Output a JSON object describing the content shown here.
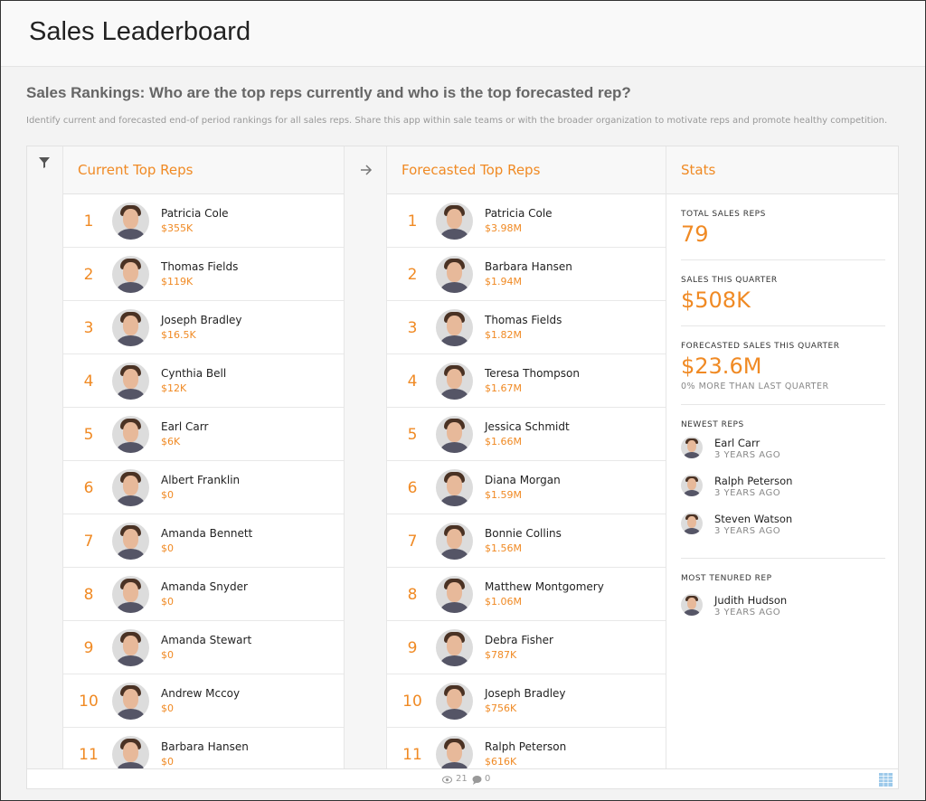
{
  "app": {
    "title": "Sales Leaderboard"
  },
  "page": {
    "heading": "Sales Rankings: Who are the top reps currently and who is the top forecasted rep?",
    "description": "Identify current and forecasted end-of period rankings for all sales reps. Share this app within sale teams or with the broader organization to motivate reps and promote healthy competition."
  },
  "colors": {
    "accent": "#f08a24"
  },
  "icons": {
    "filter": "filter-icon",
    "arrow": "arrow-right-icon",
    "views": "eye-icon",
    "comments": "comment-icon",
    "grid": "table-grid-icon"
  },
  "current": {
    "title": "Current Top Reps",
    "reps": [
      {
        "rank": "1",
        "name": "Patricia Cole",
        "amount": "$355K"
      },
      {
        "rank": "2",
        "name": "Thomas Fields",
        "amount": "$119K"
      },
      {
        "rank": "3",
        "name": "Joseph Bradley",
        "amount": "$16.5K"
      },
      {
        "rank": "4",
        "name": "Cynthia Bell",
        "amount": "$12K"
      },
      {
        "rank": "5",
        "name": "Earl Carr",
        "amount": "$6K"
      },
      {
        "rank": "6",
        "name": "Albert Franklin",
        "amount": "$0"
      },
      {
        "rank": "7",
        "name": "Amanda Bennett",
        "amount": "$0"
      },
      {
        "rank": "8",
        "name": "Amanda Snyder",
        "amount": "$0"
      },
      {
        "rank": "9",
        "name": "Amanda Stewart",
        "amount": "$0"
      },
      {
        "rank": "10",
        "name": "Andrew Mccoy",
        "amount": "$0"
      },
      {
        "rank": "11",
        "name": "Barbara Hansen",
        "amount": "$0"
      }
    ]
  },
  "forecast": {
    "title": "Forecasted Top Reps",
    "reps": [
      {
        "rank": "1",
        "name": "Patricia Cole",
        "amount": "$3.98M"
      },
      {
        "rank": "2",
        "name": "Barbara Hansen",
        "amount": "$1.94M"
      },
      {
        "rank": "3",
        "name": "Thomas Fields",
        "amount": "$1.82M"
      },
      {
        "rank": "4",
        "name": "Teresa Thompson",
        "amount": "$1.67M"
      },
      {
        "rank": "5",
        "name": "Jessica Schmidt",
        "amount": "$1.66M"
      },
      {
        "rank": "6",
        "name": "Diana Morgan",
        "amount": "$1.59M"
      },
      {
        "rank": "7",
        "name": "Bonnie Collins",
        "amount": "$1.56M"
      },
      {
        "rank": "8",
        "name": "Matthew Montgomery",
        "amount": "$1.06M"
      },
      {
        "rank": "9",
        "name": "Debra Fisher",
        "amount": "$787K"
      },
      {
        "rank": "10",
        "name": "Joseph Bradley",
        "amount": "$756K"
      },
      {
        "rank": "11",
        "name": "Ralph Peterson",
        "amount": "$616K"
      }
    ]
  },
  "stats": {
    "title": "Stats",
    "total_label": "TOTAL SALES REPS",
    "total_value": "79",
    "sales_label": "SALES THIS QUARTER",
    "sales_value": "$508K",
    "forecast_label": "FORECASTED SALES THIS QUARTER",
    "forecast_value": "$23.6M",
    "forecast_note": "0% MORE THAN LAST QUARTER",
    "newest_label": "NEWEST REPS",
    "newest": [
      {
        "name": "Earl Carr",
        "tenure": "3 YEARS AGO"
      },
      {
        "name": "Ralph Peterson",
        "tenure": "3 YEARS AGO"
      },
      {
        "name": "Steven Watson",
        "tenure": "3 YEARS AGO"
      }
    ],
    "tenured_label": "MOST TENURED REP",
    "tenured": {
      "name": "Judith Hudson",
      "tenure": "3 YEARS AGO"
    }
  },
  "footer": {
    "views": "21",
    "comments": "0"
  }
}
